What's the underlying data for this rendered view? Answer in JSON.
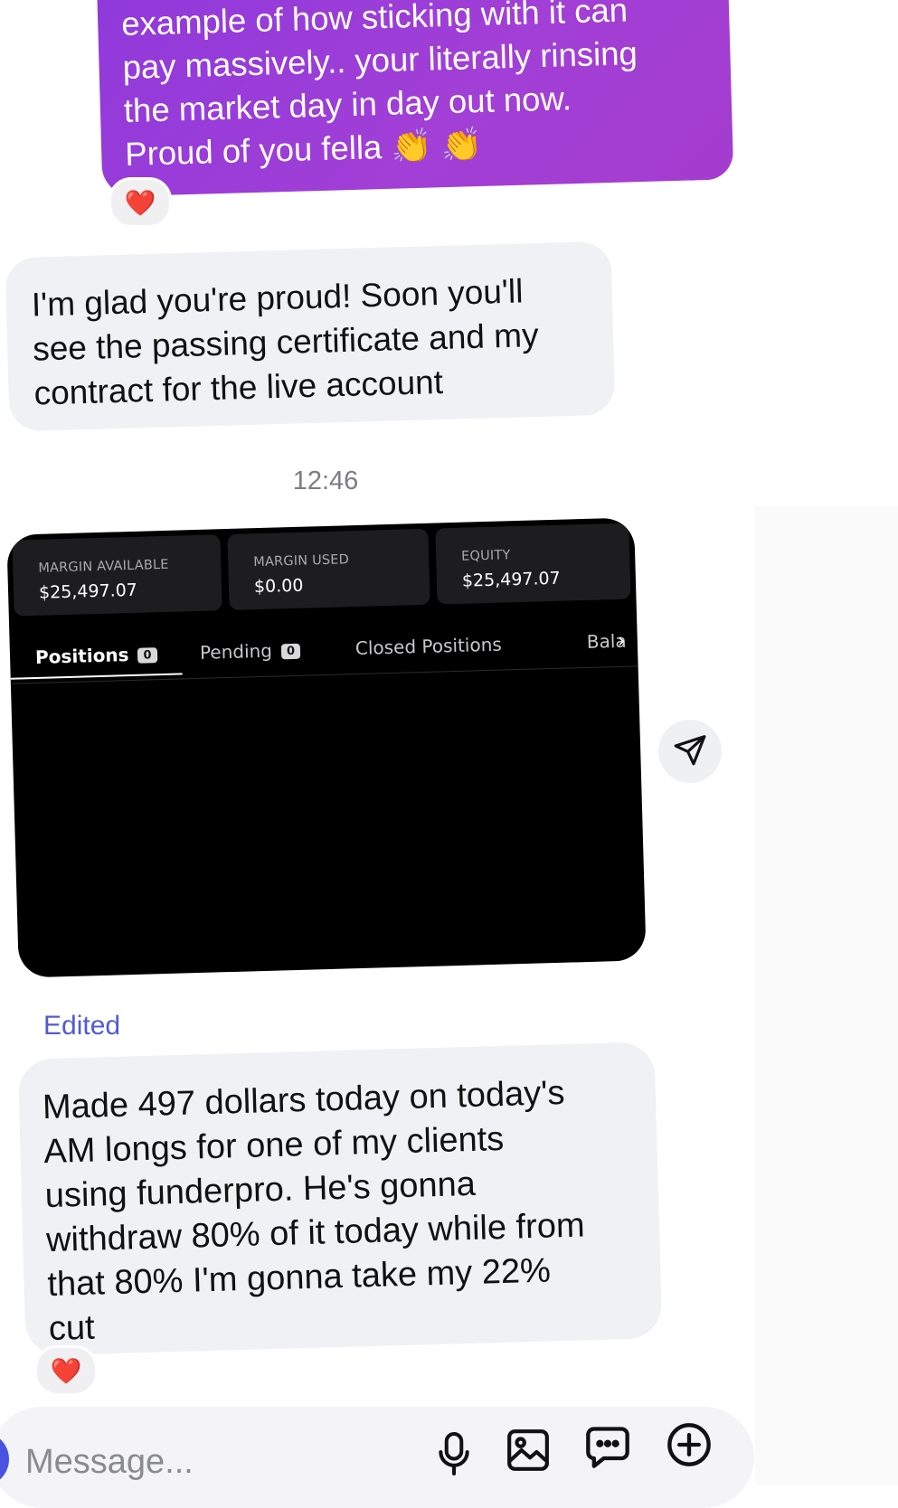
{
  "messages": {
    "outgoing_1": {
      "lines": [
        "example of how sticking with it can",
        "pay massively.. your literally rinsing",
        "the market day in day out now.",
        "Proud of you fella 👏 👏"
      ],
      "reaction": "❤️"
    },
    "incoming_1": {
      "lines": [
        "I'm glad you're proud! Soon you'll",
        "see the passing certificate and my",
        "contract for the live account"
      ]
    },
    "timestamp": "12:46",
    "edited_label": "Edited",
    "incoming_2": {
      "lines": [
        "Made 497 dollars today on today's",
        "AM longs for one of my clients",
        "using funderpro. He's gonna",
        "withdraw 80% of it today while from",
        "that 80% I'm gonna take my 22%",
        "cut"
      ],
      "reaction": "❤️"
    }
  },
  "trade_screenshot": {
    "stats": [
      {
        "label": "MARGIN AVAILABLE",
        "value": "$25,497.07"
      },
      {
        "label": "MARGIN USED",
        "value": "$0.00"
      },
      {
        "label": "EQUITY",
        "value": "$25,497.07"
      }
    ],
    "tabs": [
      {
        "label": "Positions",
        "badge": "0"
      },
      {
        "label": "Pending",
        "badge": "0"
      },
      {
        "label": "Closed Positions"
      }
    ],
    "more_tab_partial": "Bala",
    "chevron": "›"
  },
  "composer": {
    "placeholder": "Message..."
  },
  "icons": {
    "share": "send-icon",
    "mic": "microphone-icon",
    "gallery": "image-icon",
    "sticker": "chat-bubble-icon",
    "add": "plus-circle-icon"
  },
  "colors": {
    "outgoing_bubble": "#9a3dd8",
    "incoming_bubble": "#f0f1f4",
    "edited_label": "#4f5bd5",
    "heart": "#e0242f"
  }
}
